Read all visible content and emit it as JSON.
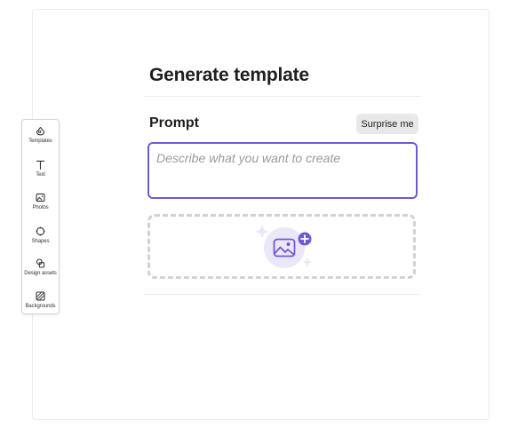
{
  "toolbar": {
    "items": [
      {
        "label": "Templates",
        "icon": "templates-icon"
      },
      {
        "label": "Text",
        "icon": "text-icon"
      },
      {
        "label": "Photos",
        "icon": "photos-icon"
      },
      {
        "label": "Shapes",
        "icon": "shapes-icon"
      },
      {
        "label": "Design assets",
        "icon": "design-assets-icon"
      },
      {
        "label": "Backgrounds",
        "icon": "backgrounds-icon"
      }
    ]
  },
  "panel": {
    "title": "Generate template",
    "prompt_label": "Prompt",
    "surprise_label": "Surprise me",
    "prompt_value": "",
    "prompt_placeholder": "Describe what you want to create"
  },
  "upload": {
    "icon": "image-add-icon",
    "accent_color": "#6e5ad2"
  },
  "colors": {
    "accent": "#6e5ad2",
    "upload_bg": "#ebe7f8"
  }
}
